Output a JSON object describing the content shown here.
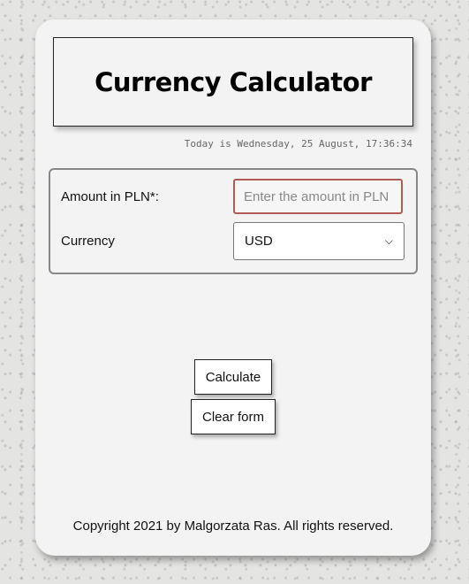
{
  "header": {
    "title": "Currency Calculator",
    "date_text": "Today is Wednesday, 25 August, 17:36:34"
  },
  "form": {
    "amount_label": "Amount in PLN*:",
    "amount_value": "",
    "amount_placeholder": "Enter the amount in PLN",
    "currency_label": "Currency",
    "currency_selected": "USD"
  },
  "buttons": {
    "calculate_label": "Calculate",
    "clear_label": "Clear form"
  },
  "footer": {
    "copyright": "Copyright 2021 by Malgorzata Ras. All rights reserved."
  },
  "colors": {
    "card_background": "#f3f3f3",
    "input_error_border": "#b15a5a"
  },
  "icons": {
    "select_arrow": "chevron-down-icon"
  }
}
